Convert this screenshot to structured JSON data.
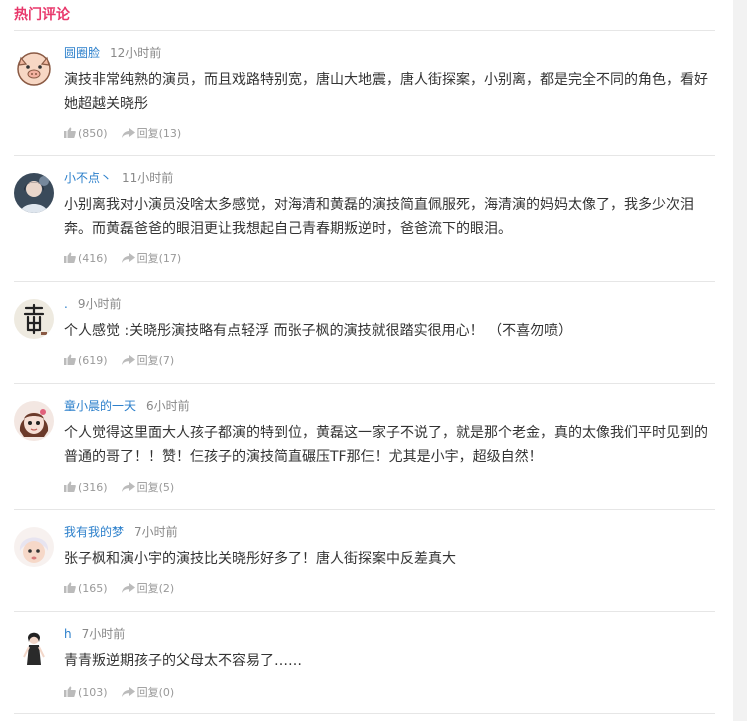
{
  "section": {
    "title": "热门评论"
  },
  "labels": {
    "reply": "回复"
  },
  "comments": [
    {
      "user": "圆圈脸",
      "time": "12小时前",
      "text": "演技非常纯熟的演员，而且戏路特别宽，唐山大地震，唐人街探案，小别离，都是完全不同的角色，看好她超越关晓彤",
      "likes": "(850)",
      "replies": "(13)",
      "avatar": "pig-avatar"
    },
    {
      "user": "小不点丶",
      "time": "11小时前",
      "text": "小别离我对小演员没啥太多感觉，对海清和黄磊的演技简直佩服死，海清演的妈妈太像了，我多少次泪奔。而黄磊爸爸的眼泪更让我想起自己青春期叛逆时，爸爸流下的眼泪。",
      "likes": "(416)",
      "replies": "(17)",
      "avatar": "girl-avatar"
    },
    {
      "user": ".",
      "time": "9小时前",
      "text": "个人感觉 :关晓彤演技略有点轻浮  而张子枫的演技就很踏实很用心！  （不喜勿喷）",
      "likes": "(619)",
      "replies": "(7)",
      "avatar": "calligraphy-avatar"
    },
    {
      "user": "童小晨的一天",
      "time": "6小时前",
      "text": "个人觉得这里面大人孩子都演的特到位，黄磊这一家子不说了，就是那个老金，真的太像我们平时见到的普通的哥了！！赞！仨孩子的演技简直碾压TF那仨！尤其是小宇，超级自然！",
      "likes": "(316)",
      "replies": "(5)",
      "avatar": "doll-avatar"
    },
    {
      "user": "我有我的梦",
      "time": "7小时前",
      "text": "张子枫和演小宇的演技比关晓彤好多了！唐人街探案中反差真大",
      "likes": "(165)",
      "replies": "(2)",
      "avatar": "baby-avatar"
    },
    {
      "user": "h",
      "time": "7小时前",
      "text": "青青叛逆期孩子的父母太不容易了……",
      "likes": "(103)",
      "replies": "(0)",
      "avatar": "figure-avatar"
    }
  ],
  "colors": {
    "accent": "#e8386b",
    "link": "#2b7fcb",
    "divider": "#e6e6e6"
  }
}
